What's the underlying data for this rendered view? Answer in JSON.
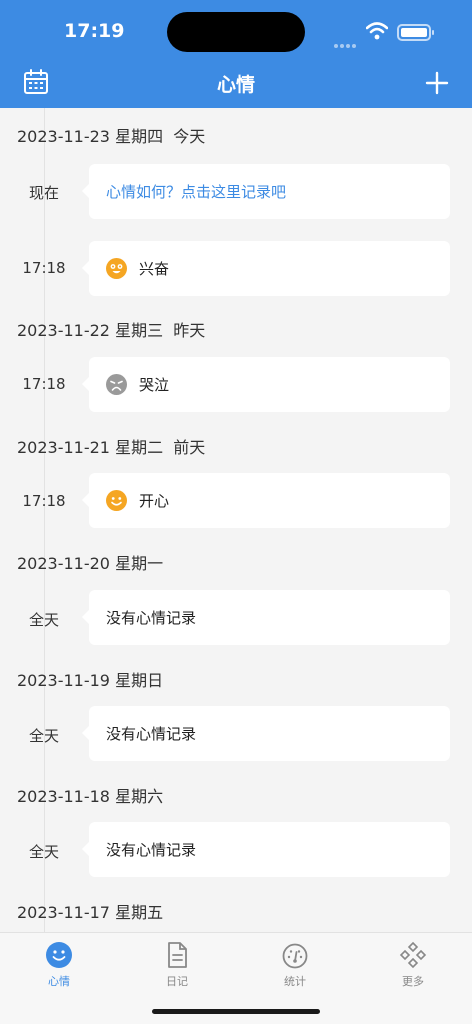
{
  "status_bar": {
    "time": "17:19"
  },
  "nav": {
    "title": "心情",
    "left_icon": "calendar-icon",
    "right_icon": "plus-icon"
  },
  "timeline": {
    "day1": {
      "date": "2023-11-23 星期四",
      "relative": "今天"
    },
    "now_label": "现在",
    "prompt_text": "心情如何？点击这里记录吧",
    "entry1": {
      "time": "17:18",
      "mood": "兴奋",
      "icon": "excited-face-icon"
    },
    "day2": {
      "date": "2023-11-22 星期三",
      "relative": "昨天"
    },
    "entry2": {
      "time": "17:18",
      "mood": "哭泣",
      "icon": "crying-face-icon"
    },
    "day3": {
      "date": "2023-11-21 星期二",
      "relative": "前天"
    },
    "entry3": {
      "time": "17:18",
      "mood": "开心",
      "icon": "happy-face-icon"
    },
    "day4": {
      "date": "2023-11-20 星期一"
    },
    "day5": {
      "date": "2023-11-19 星期日"
    },
    "day6": {
      "date": "2023-11-18 星期六"
    },
    "day7": {
      "date": "2023-11-17 星期五"
    },
    "all_day_label": "全天",
    "no_record_text": "没有心情记录"
  },
  "tabbar": {
    "tabs": [
      {
        "label": "心情",
        "icon": "smile-icon"
      },
      {
        "label": "日记",
        "icon": "document-icon"
      },
      {
        "label": "统计",
        "icon": "gauge-icon"
      },
      {
        "label": "更多",
        "icon": "diamond-grid-icon"
      }
    ]
  },
  "colors": {
    "accent": "#3d8be3",
    "mood_yellow": "#f5a623",
    "mood_gray": "#9a9a9a"
  }
}
